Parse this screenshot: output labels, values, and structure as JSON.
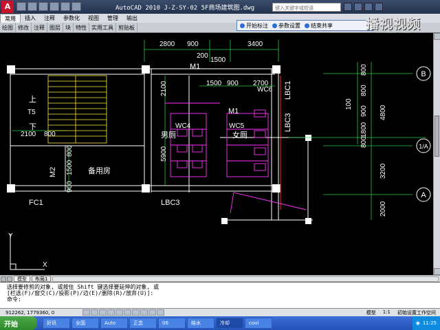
{
  "window": {
    "title": "AutoCAD 2010  J-Z-SY-02 5F商场建筑图.dwg",
    "search_placeholder": "键入关键字或短语",
    "logo": "A"
  },
  "watermark": {
    "main": "播视视频",
    "sub": "tv.sohu.com"
  },
  "menu": [
    "常用",
    "插入",
    "注释",
    "参数化",
    "视图",
    "管理",
    "输出"
  ],
  "ribbon": [
    "绘图",
    "修改",
    "注释",
    "图层",
    "块",
    "特性",
    "实用工具",
    "剪贴板"
  ],
  "floatbar": {
    "start": "开始标注",
    "params": "参数设置",
    "end": "结束共享"
  },
  "drawing": {
    "dims_top": [
      "2800",
      "900",
      "200",
      "1500",
      "3400"
    ],
    "dims_mid": [
      "1500",
      "900",
      "2700"
    ],
    "dims_left": [
      "2100",
      "800"
    ],
    "dims_vertical": [
      "2100",
      "5900",
      "1500",
      "800",
      "900"
    ],
    "dims_right": [
      "800",
      "800",
      "100",
      "900",
      "1800",
      "800",
      "4800",
      "3200",
      "2000"
    ],
    "labels": {
      "up": "上",
      "down": "下",
      "t5": "T5",
      "m1a": "M1",
      "m1b": "M1",
      "m2": "M2",
      "wc4": "WC4",
      "wc5": "WC5",
      "wc6": "WC6",
      "men": "男厕",
      "women": "女厕",
      "spare": "备用房",
      "fc1": "FC1",
      "lbc1": "LBC1",
      "lbc3a": "LBC3",
      "lbc3b": "LBC3"
    },
    "grid_bubbles": [
      "B",
      "1/A",
      "A"
    ],
    "ucs": {
      "y": "Y",
      "x": "X"
    }
  },
  "layout_tabs": [
    "模型",
    "布局1"
  ],
  "command": {
    "line1": "选择要修剪的对象, 或按住 Shift 键选择要延伸的对象, 或",
    "line2": "[栏选(F)/窗交(C)/投影(P)/边(E)/删除(R)/放弃(U)]:",
    "line3": "命令:"
  },
  "status": {
    "coords": "912262, 1779360, 0",
    "model": "模型",
    "scale": "1:1",
    "workspace": "初始设置工作空间"
  },
  "taskbar": {
    "start": "开始",
    "tasks": [
      "好讯",
      "全国",
      "Auto",
      "正念",
      "06",
      "结水",
      "冷却",
      "cool"
    ],
    "active_index": 6,
    "clock": "11:25"
  }
}
